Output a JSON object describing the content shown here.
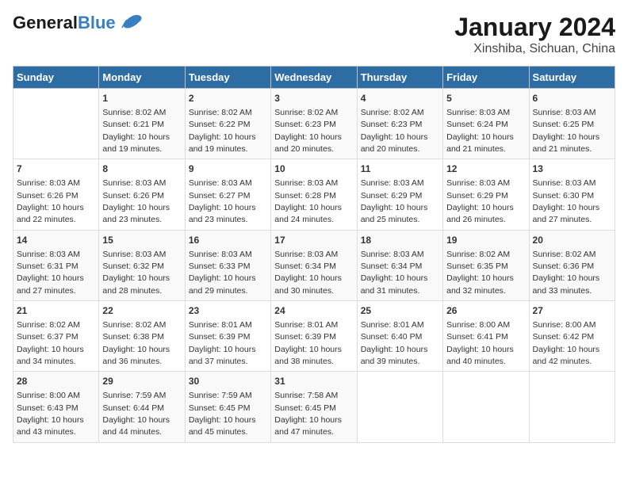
{
  "header": {
    "logo_general": "General",
    "logo_blue": "Blue",
    "title": "January 2024",
    "subtitle": "Xinshiba, Sichuan, China"
  },
  "days_of_week": [
    "Sunday",
    "Monday",
    "Tuesday",
    "Wednesday",
    "Thursday",
    "Friday",
    "Saturday"
  ],
  "weeks": [
    [
      {
        "day": "",
        "info": ""
      },
      {
        "day": "1",
        "info": "Sunrise: 8:02 AM\nSunset: 6:21 PM\nDaylight: 10 hours\nand 19 minutes."
      },
      {
        "day": "2",
        "info": "Sunrise: 8:02 AM\nSunset: 6:22 PM\nDaylight: 10 hours\nand 19 minutes."
      },
      {
        "day": "3",
        "info": "Sunrise: 8:02 AM\nSunset: 6:23 PM\nDaylight: 10 hours\nand 20 minutes."
      },
      {
        "day": "4",
        "info": "Sunrise: 8:02 AM\nSunset: 6:23 PM\nDaylight: 10 hours\nand 20 minutes."
      },
      {
        "day": "5",
        "info": "Sunrise: 8:03 AM\nSunset: 6:24 PM\nDaylight: 10 hours\nand 21 minutes."
      },
      {
        "day": "6",
        "info": "Sunrise: 8:03 AM\nSunset: 6:25 PM\nDaylight: 10 hours\nand 21 minutes."
      }
    ],
    [
      {
        "day": "7",
        "info": "Sunrise: 8:03 AM\nSunset: 6:26 PM\nDaylight: 10 hours\nand 22 minutes."
      },
      {
        "day": "8",
        "info": "Sunrise: 8:03 AM\nSunset: 6:26 PM\nDaylight: 10 hours\nand 23 minutes."
      },
      {
        "day": "9",
        "info": "Sunrise: 8:03 AM\nSunset: 6:27 PM\nDaylight: 10 hours\nand 23 minutes."
      },
      {
        "day": "10",
        "info": "Sunrise: 8:03 AM\nSunset: 6:28 PM\nDaylight: 10 hours\nand 24 minutes."
      },
      {
        "day": "11",
        "info": "Sunrise: 8:03 AM\nSunset: 6:29 PM\nDaylight: 10 hours\nand 25 minutes."
      },
      {
        "day": "12",
        "info": "Sunrise: 8:03 AM\nSunset: 6:29 PM\nDaylight: 10 hours\nand 26 minutes."
      },
      {
        "day": "13",
        "info": "Sunrise: 8:03 AM\nSunset: 6:30 PM\nDaylight: 10 hours\nand 27 minutes."
      }
    ],
    [
      {
        "day": "14",
        "info": "Sunrise: 8:03 AM\nSunset: 6:31 PM\nDaylight: 10 hours\nand 27 minutes."
      },
      {
        "day": "15",
        "info": "Sunrise: 8:03 AM\nSunset: 6:32 PM\nDaylight: 10 hours\nand 28 minutes."
      },
      {
        "day": "16",
        "info": "Sunrise: 8:03 AM\nSunset: 6:33 PM\nDaylight: 10 hours\nand 29 minutes."
      },
      {
        "day": "17",
        "info": "Sunrise: 8:03 AM\nSunset: 6:34 PM\nDaylight: 10 hours\nand 30 minutes."
      },
      {
        "day": "18",
        "info": "Sunrise: 8:03 AM\nSunset: 6:34 PM\nDaylight: 10 hours\nand 31 minutes."
      },
      {
        "day": "19",
        "info": "Sunrise: 8:02 AM\nSunset: 6:35 PM\nDaylight: 10 hours\nand 32 minutes."
      },
      {
        "day": "20",
        "info": "Sunrise: 8:02 AM\nSunset: 6:36 PM\nDaylight: 10 hours\nand 33 minutes."
      }
    ],
    [
      {
        "day": "21",
        "info": "Sunrise: 8:02 AM\nSunset: 6:37 PM\nDaylight: 10 hours\nand 34 minutes."
      },
      {
        "day": "22",
        "info": "Sunrise: 8:02 AM\nSunset: 6:38 PM\nDaylight: 10 hours\nand 36 minutes."
      },
      {
        "day": "23",
        "info": "Sunrise: 8:01 AM\nSunset: 6:39 PM\nDaylight: 10 hours\nand 37 minutes."
      },
      {
        "day": "24",
        "info": "Sunrise: 8:01 AM\nSunset: 6:39 PM\nDaylight: 10 hours\nand 38 minutes."
      },
      {
        "day": "25",
        "info": "Sunrise: 8:01 AM\nSunset: 6:40 PM\nDaylight: 10 hours\nand 39 minutes."
      },
      {
        "day": "26",
        "info": "Sunrise: 8:00 AM\nSunset: 6:41 PM\nDaylight: 10 hours\nand 40 minutes."
      },
      {
        "day": "27",
        "info": "Sunrise: 8:00 AM\nSunset: 6:42 PM\nDaylight: 10 hours\nand 42 minutes."
      }
    ],
    [
      {
        "day": "28",
        "info": "Sunrise: 8:00 AM\nSunset: 6:43 PM\nDaylight: 10 hours\nand 43 minutes."
      },
      {
        "day": "29",
        "info": "Sunrise: 7:59 AM\nSunset: 6:44 PM\nDaylight: 10 hours\nand 44 minutes."
      },
      {
        "day": "30",
        "info": "Sunrise: 7:59 AM\nSunset: 6:45 PM\nDaylight: 10 hours\nand 45 minutes."
      },
      {
        "day": "31",
        "info": "Sunrise: 7:58 AM\nSunset: 6:45 PM\nDaylight: 10 hours\nand 47 minutes."
      },
      {
        "day": "",
        "info": ""
      },
      {
        "day": "",
        "info": ""
      },
      {
        "day": "",
        "info": ""
      }
    ]
  ]
}
